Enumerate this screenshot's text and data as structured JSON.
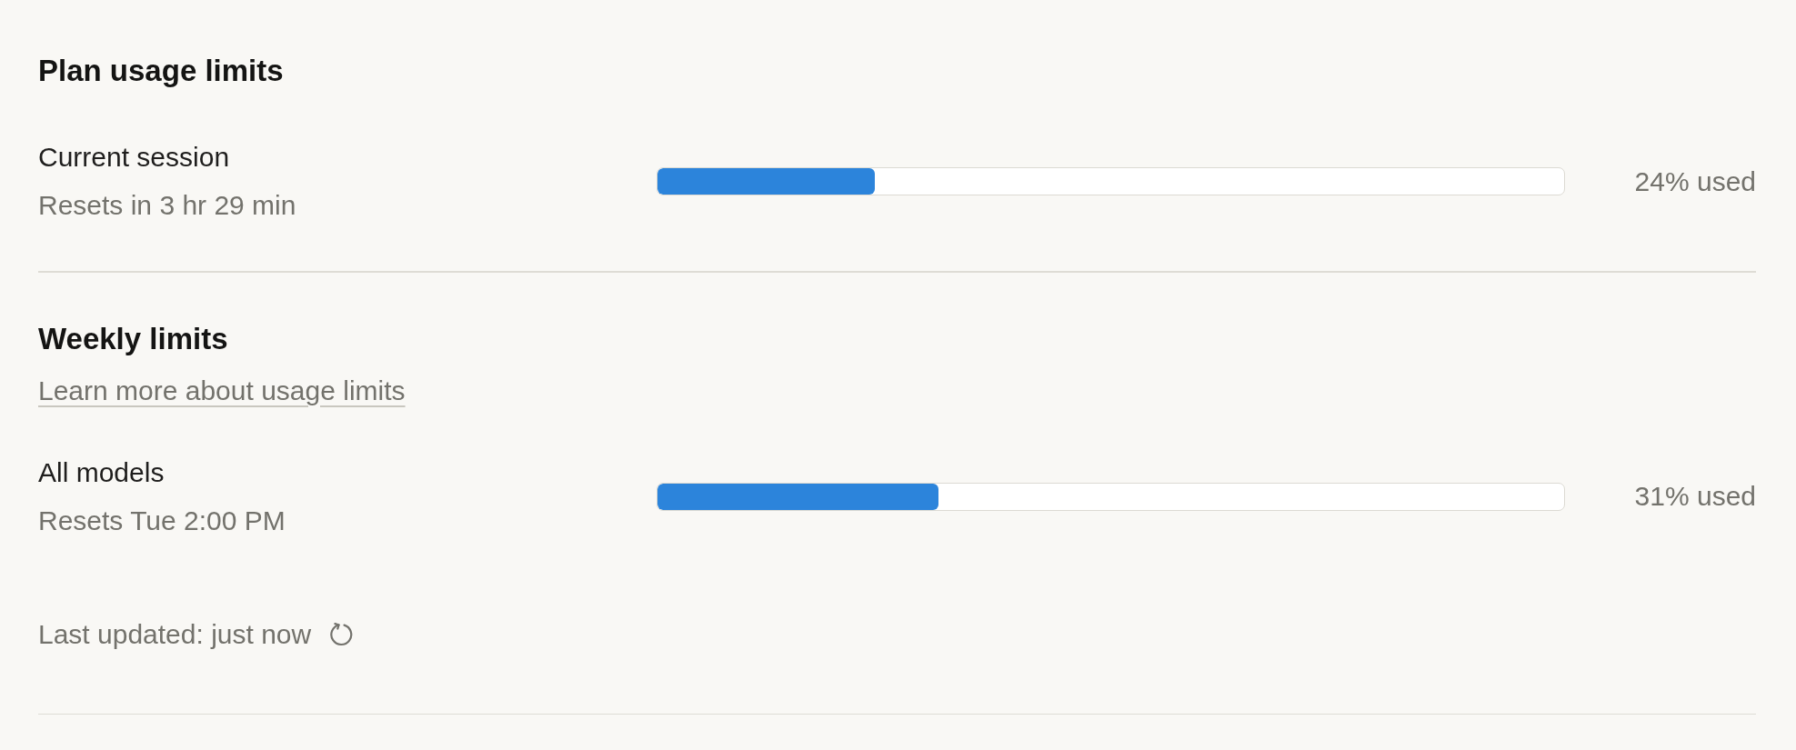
{
  "sections": [
    {
      "title": "Plan usage limits",
      "limits": [
        {
          "name": "Current session",
          "reset": "Resets in 3 hr 29 min",
          "level": 0.24,
          "reading": "24% used"
        }
      ]
    },
    {
      "title": "Weekly limits",
      "link": "Learn more about usage limits",
      "limits": [
        {
          "name": "All models",
          "reset": "Resets Tue 2:00 PM",
          "level": 0.31,
          "reading": "31% used"
        }
      ]
    }
  ],
  "status": {
    "text": "Last updated: just now"
  }
}
